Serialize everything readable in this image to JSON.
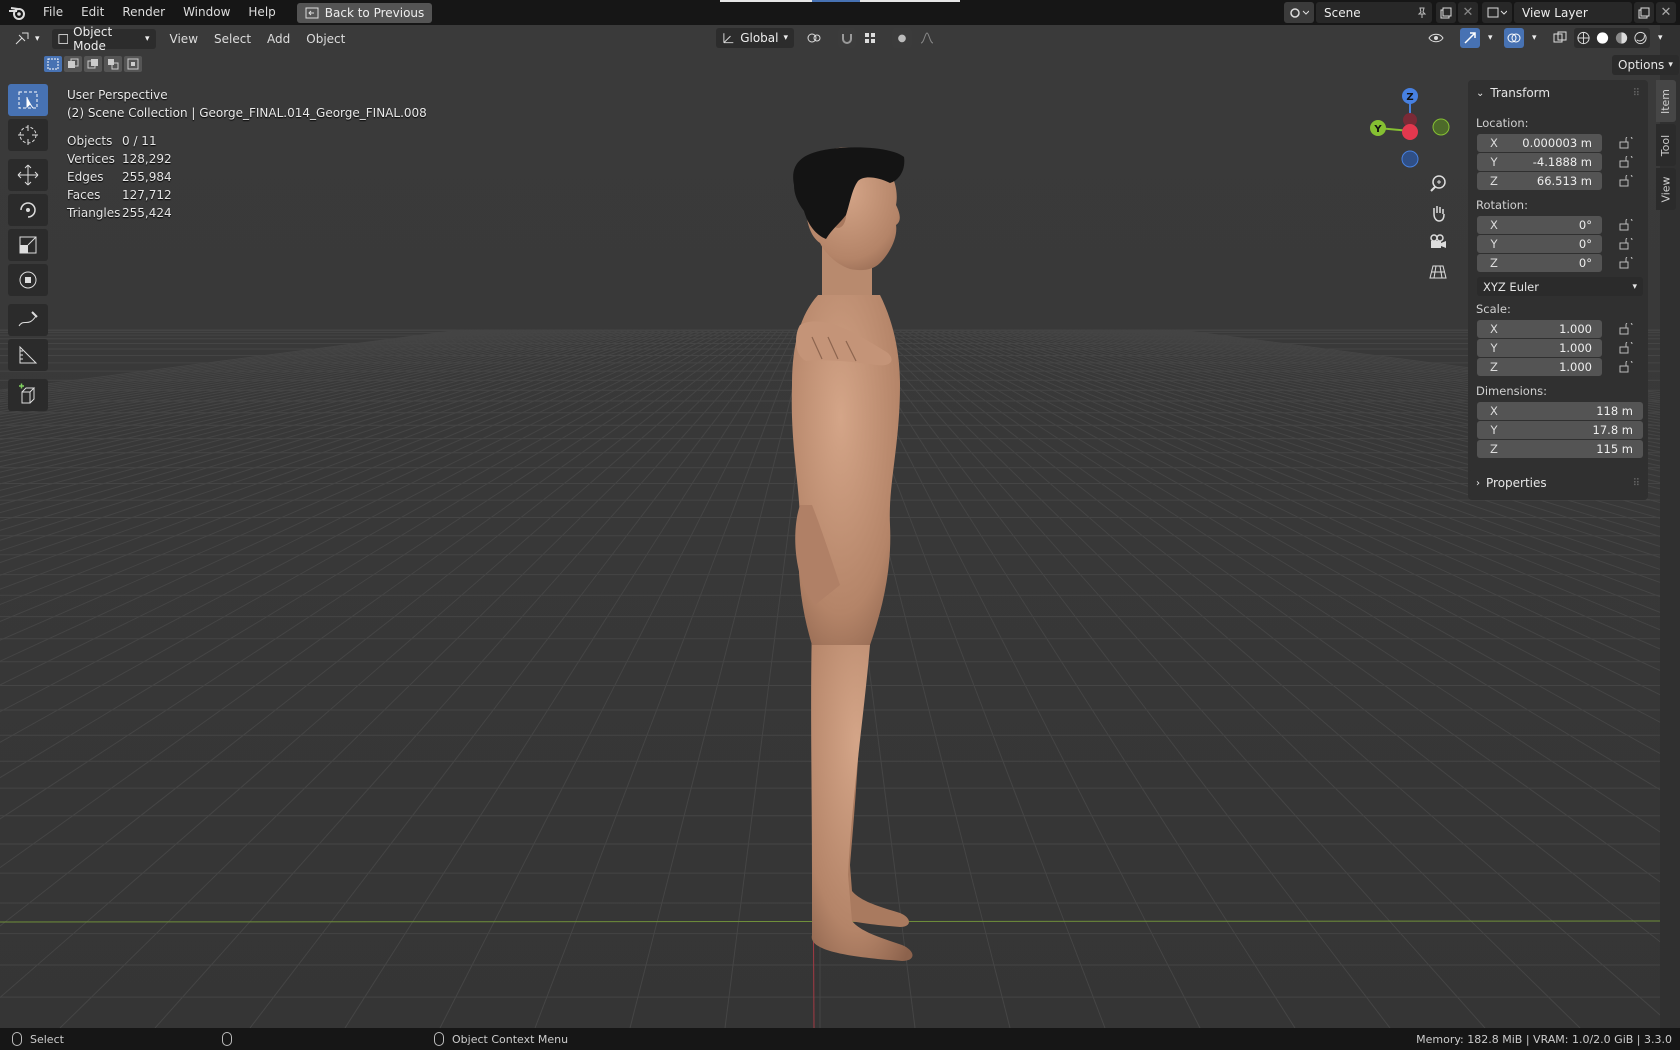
{
  "topbar": {
    "menus": [
      "File",
      "Edit",
      "Render",
      "Window",
      "Help"
    ],
    "back_label": "Back to Previous",
    "scene_label": "Scene",
    "view_layer_label": "View Layer"
  },
  "viewport_header": {
    "mode": "Object Mode",
    "menus": [
      "View",
      "Select",
      "Add",
      "Object"
    ],
    "transform_orientation": "Global",
    "options_label": "Options"
  },
  "overlay": {
    "perspective": "User Perspective",
    "collection": "(2) Scene Collection | George_FINAL.014_George_FINAL.008",
    "stats": [
      {
        "key": "Objects",
        "value": "0 / 11"
      },
      {
        "key": "Vertices",
        "value": "128,292"
      },
      {
        "key": "Edges",
        "value": "255,984"
      },
      {
        "key": "Faces",
        "value": "127,712"
      },
      {
        "key": "Triangles",
        "value": "255,424"
      }
    ]
  },
  "gizmo": {
    "x": "X",
    "y": "Y",
    "z": "Z"
  },
  "npanel": {
    "transform_title": "Transform",
    "location_label": "Location:",
    "location": [
      {
        "axis": "X",
        "value": "0.000003 m"
      },
      {
        "axis": "Y",
        "value": "-4.1888 m"
      },
      {
        "axis": "Z",
        "value": "66.513 m"
      }
    ],
    "rotation_label": "Rotation:",
    "rotation": [
      {
        "axis": "X",
        "value": "0°"
      },
      {
        "axis": "Y",
        "value": "0°"
      },
      {
        "axis": "Z",
        "value": "0°"
      }
    ],
    "rotation_mode": "XYZ Euler",
    "scale_label": "Scale:",
    "scale": [
      {
        "axis": "X",
        "value": "1.000"
      },
      {
        "axis": "Y",
        "value": "1.000"
      },
      {
        "axis": "Z",
        "value": "1.000"
      }
    ],
    "dimensions_label": "Dimensions:",
    "dimensions": [
      {
        "axis": "X",
        "value": "118 m"
      },
      {
        "axis": "Y",
        "value": "17.8 m"
      },
      {
        "axis": "Z",
        "value": "115 m"
      }
    ],
    "properties_title": "Properties",
    "tabs": [
      "Item",
      "Tool",
      "View"
    ]
  },
  "statusbar": {
    "select": "Select",
    "context_menu": "Object Context Menu",
    "info": "Memory: 182.8 MiB | VRAM: 1.0/2.0 GiB | 3.3.0"
  },
  "colors": {
    "accent": "#4772b3",
    "x_axis": "#e3384e",
    "y_axis": "#85c032",
    "z_axis": "#4780e0",
    "skin": "#c49478",
    "hair": "#141414"
  }
}
